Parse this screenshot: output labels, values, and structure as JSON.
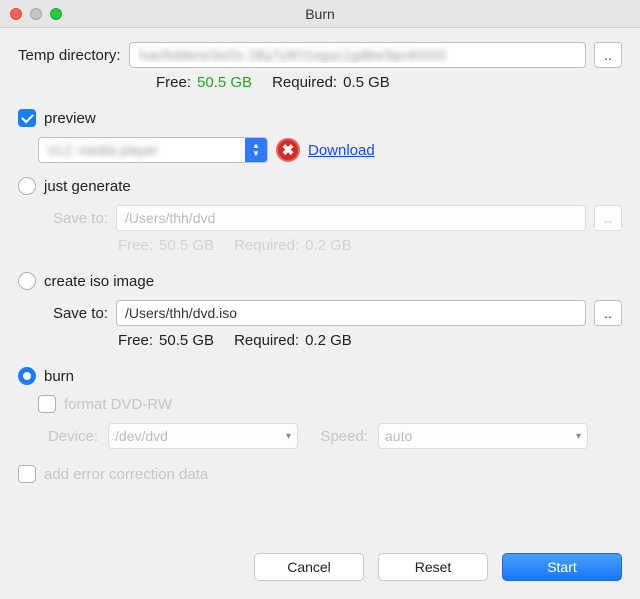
{
  "window": {
    "title": "Burn"
  },
  "tempDir": {
    "label": "Temp directory:",
    "value": "/var/folders/3s/0x 2By7y9O1xguc1gdbw3pc40000",
    "freeLabel": "Free:",
    "freeValue": "50.5 GB",
    "reqLabel": "Required:",
    "reqValue": "0.5 GB",
    "browse": ".."
  },
  "preview": {
    "label": "preview",
    "player": "VLC media player",
    "download": "Download"
  },
  "justGenerate": {
    "label": "just generate",
    "saveLabel": "Save to:",
    "path": "/Users/thh/dvd",
    "freeLabel": "Free:",
    "freeValue": "50.5 GB",
    "reqLabel": "Required:",
    "reqValue": "0.2 GB",
    "browse": ".."
  },
  "createIso": {
    "label": "create iso image",
    "saveLabel": "Save to:",
    "path": "/Users/thh/dvd.iso",
    "freeLabel": "Free:",
    "freeValue": "50.5 GB",
    "reqLabel": "Required:",
    "reqValue": "0.2 GB",
    "browse": ".."
  },
  "burn": {
    "label": "burn",
    "formatLabel": "format DVD-RW",
    "deviceLabel": "Device:",
    "device": "/dev/dvd",
    "speedLabel": "Speed:",
    "speed": "auto"
  },
  "addErrCorr": {
    "label": "add error correction data"
  },
  "buttons": {
    "cancel": "Cancel",
    "reset": "Reset",
    "start": "Start"
  }
}
